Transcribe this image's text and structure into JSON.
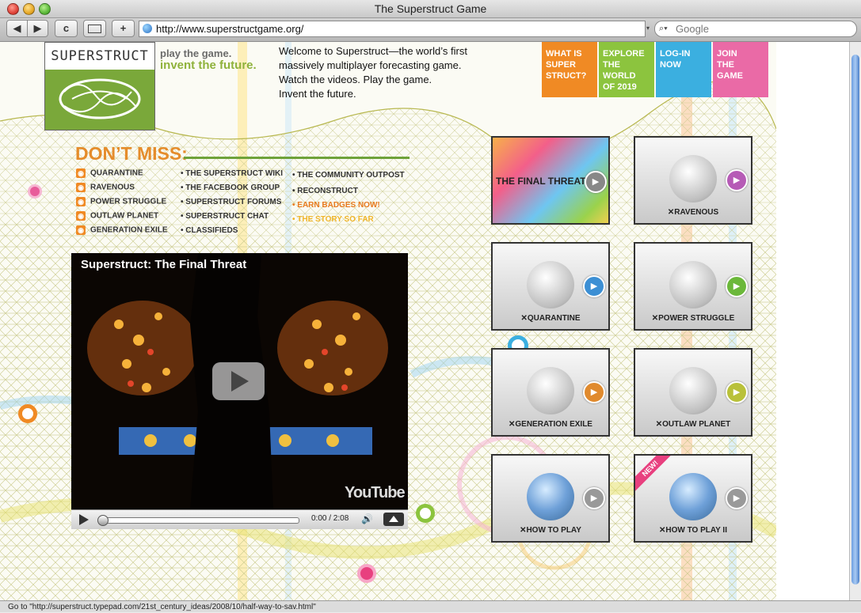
{
  "window": {
    "title": "The Superstruct Game"
  },
  "toolbar": {
    "back_label": "◀",
    "forward_label": "▶",
    "reload_label": "c",
    "add_label": "+",
    "url": "http://www.superstructgame.org/",
    "search_placeholder": "Google"
  },
  "status": {
    "text": "Go to \"http://superstruct.typepad.com/21st_century_ideas/2008/10/half-way-to-sav.html\""
  },
  "site": {
    "logo_text": "SUPERSTRUCT",
    "tagline_1": "play the game.",
    "tagline_2": "invent the future.",
    "intro": [
      "Welcome to Superstruct—the world’s first",
      "massively multiplayer forecasting game.",
      "Watch the videos. Play the game.",
      "Invent the future."
    ],
    "nav": [
      {
        "lines": [
          "WHAT IS",
          "SUPER",
          "STRUCT?"
        ],
        "color": "#f08a24"
      },
      {
        "lines": [
          "EXPLORE",
          "THE WORLD",
          "OF 2019"
        ],
        "color": "#8cc43e"
      },
      {
        "lines": [
          "LOG-IN",
          "NOW"
        ],
        "color": "#3bafe0"
      },
      {
        "lines": [
          "JOIN",
          "THE",
          "GAME"
        ],
        "color": "#ea6aa6"
      }
    ]
  },
  "dont_miss": {
    "heading": "DON’T MISS:",
    "rss_items": [
      "QUARANTINE",
      "RAVENOUS",
      "POWER STRUGGLE",
      "OUTLAW PLANET",
      "GENERATION EXILE"
    ],
    "links_col2": [
      "• THE SUPERSTRUCT WIKI",
      "• THE FACEBOOK GROUP",
      "• SUPERSTRUCT FORUMS",
      "• SUPERSTRUCT CHAT",
      "• CLASSIFIEDS"
    ],
    "links_col3": [
      "• THE COMMUNITY OUTPOST",
      "• RECONSTRUCT"
    ],
    "highlight_links": [
      "• EARN BADGES NOW!",
      "• THE STORY SO FAR"
    ]
  },
  "video": {
    "title": "Superstruct: The Final Threat",
    "time": "0:00 / 2:08",
    "youtube": "YouTube"
  },
  "tiles": [
    {
      "label": "THE FINAL THREAT",
      "play_color": "#888888"
    },
    {
      "label": "✕RAVENOUS",
      "play_color": "#b65bb6"
    },
    {
      "label": "✕QUARANTINE",
      "play_color": "#3c8fd4"
    },
    {
      "label": "✕POWER STRUGGLE",
      "play_color": "#6bb83a"
    },
    {
      "label": "✕GENERATION EXILE",
      "play_color": "#e08a2e"
    },
    {
      "label": "✕OUTLAW PLANET",
      "play_color": "#b9c13a"
    },
    {
      "label": "✕HOW TO PLAY",
      "play_color": "#999999"
    },
    {
      "label": "✕HOW TO PLAY II",
      "play_color": "#999999",
      "badge": "NEW!"
    }
  ]
}
